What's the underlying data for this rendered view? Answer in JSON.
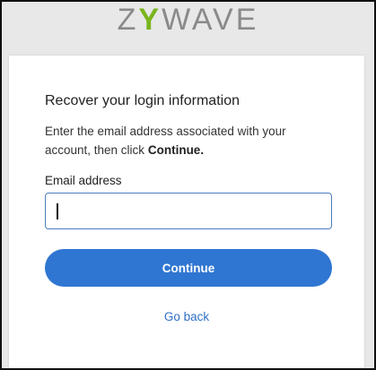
{
  "brand": {
    "logo_left": "Z",
    "logo_mark": "Y",
    "logo_right": "WAVE"
  },
  "card": {
    "title": "Recover your login information",
    "description": "Enter the email address associated with your account, then click",
    "description_bold": "Continue.",
    "email_label": "Email address",
    "email_value": "",
    "continue_label": "Continue",
    "go_back_label": "Go back"
  },
  "colors": {
    "primary_button": "#2f76d2",
    "link": "#2f6fc6",
    "logo_gray": "#8a8a8a",
    "logo_green": "#7ab51d"
  }
}
